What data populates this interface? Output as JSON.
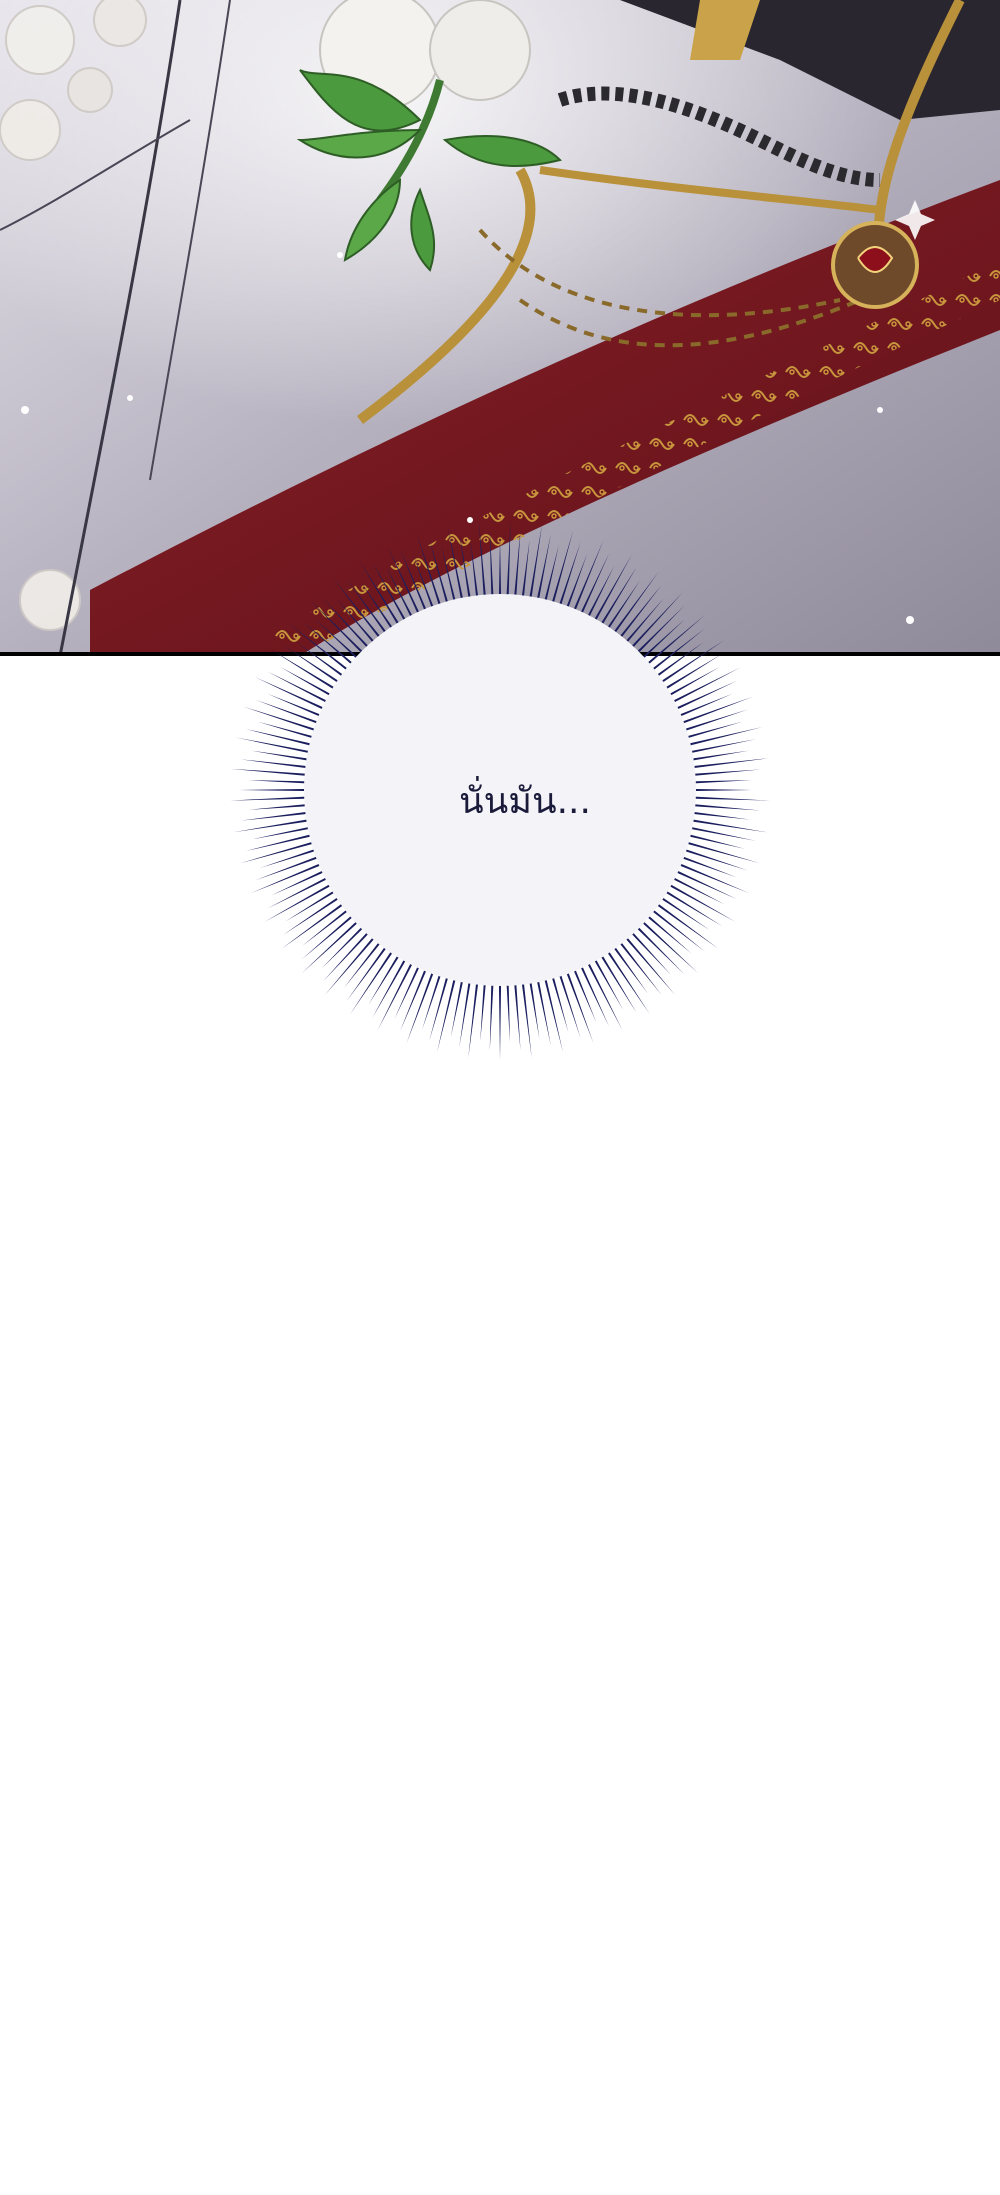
{
  "panel": {
    "scene": "illustration",
    "colors": {
      "sash": "#7a1a22",
      "sash_pattern": "#c8963c",
      "robe": "#bdb8c4",
      "robe_shadow": "#9c97a6",
      "gold": "#b8913a",
      "leaf": "#3f8a3a",
      "flower": "#f3f1ee",
      "border": "#000000"
    }
  },
  "speech": {
    "text": "นั่นมัน...",
    "burst_color": "#1c1f5e",
    "bubble_fill": "#f4f4f8"
  }
}
